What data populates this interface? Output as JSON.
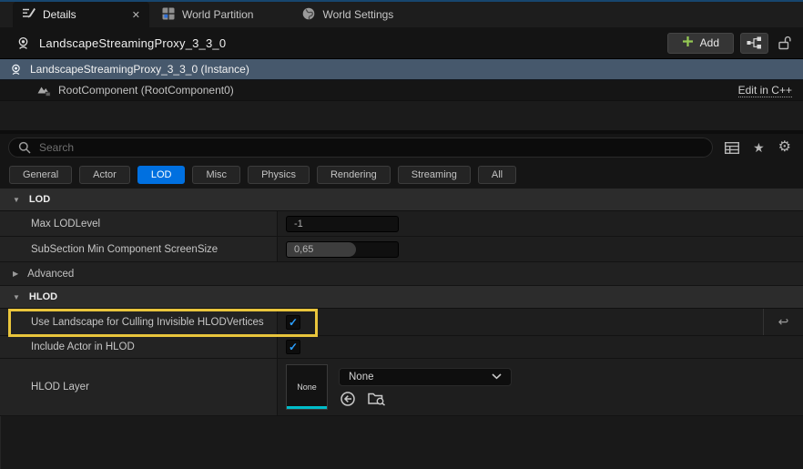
{
  "tabs": {
    "details": {
      "label": "Details"
    },
    "world_partition": {
      "label": "World Partition"
    },
    "world_settings": {
      "label": "World Settings"
    }
  },
  "header": {
    "title": "LandscapeStreamingProxy_3_3_0",
    "add_label": "Add"
  },
  "tree": {
    "instance_label": "LandscapeStreamingProxy_3_3_0 (Instance)",
    "root_component_label": "RootComponent (RootComponent0)",
    "edit_cpp_label": "Edit in C++"
  },
  "search": {
    "placeholder": "Search"
  },
  "filters": {
    "items": [
      "General",
      "Actor",
      "LOD",
      "Misc",
      "Physics",
      "Rendering",
      "Streaming",
      "All"
    ],
    "active": "LOD"
  },
  "lod_section": {
    "title": "LOD",
    "max_lod_level": {
      "label": "Max LODLevel",
      "value": "-1"
    },
    "subsection_min": {
      "label": "SubSection Min Component ScreenSize",
      "value": "0,65",
      "fill_percent": 62
    },
    "advanced_label": "Advanced"
  },
  "hlod_section": {
    "title": "HLOD",
    "use_landscape": {
      "label": "Use Landscape for Culling Invisible HLODVertices",
      "checked": true
    },
    "include_actor": {
      "label": "Include Actor in HLOD",
      "checked": true
    },
    "hlod_layer": {
      "label": "HLOD Layer",
      "thumbnail_label": "None",
      "dropdown_value": "None"
    }
  },
  "icons": {
    "check": "✓",
    "close": "✕",
    "star": "★",
    "gear": "⚙",
    "reset": "↩",
    "caret_down": "▼",
    "caret_right": "▶"
  },
  "colors": {
    "accent_blue": "#0070e0",
    "selection_blue_gray": "#46586c",
    "highlight_yellow": "#e9c53c",
    "check_blue": "#2b9fff",
    "thumbnail_teal": "#00bcc9",
    "add_green": "#95c954",
    "topline_blue": "#17466f"
  }
}
